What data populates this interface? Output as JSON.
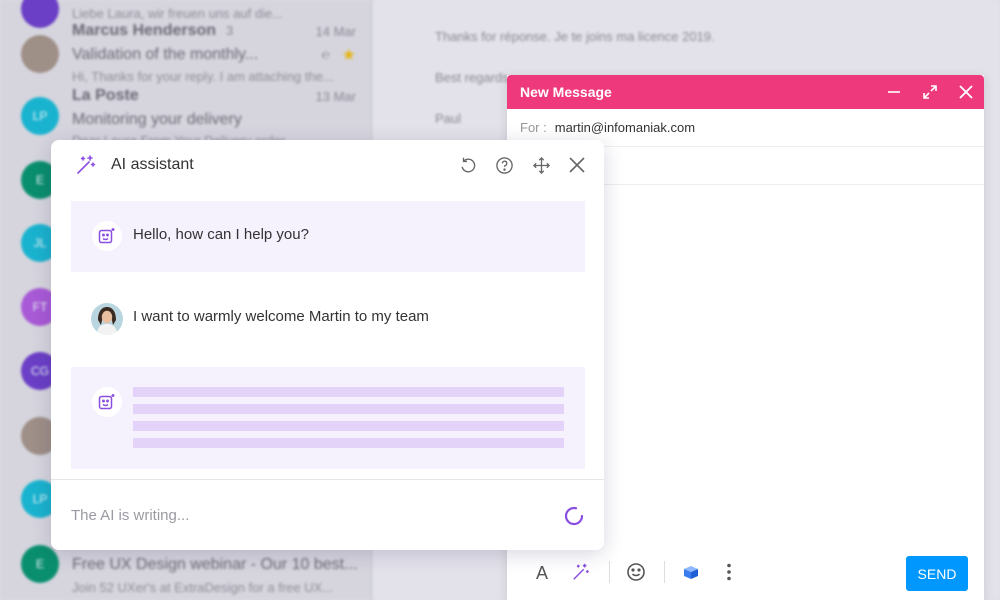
{
  "mail_list": {
    "rows": [
      {
        "preview": "Liebe Laura, wir freuen uns auf die..."
      },
      {
        "sender": "Marcus Henderson",
        "count": "3",
        "date": "14 Mar",
        "subject": "Validation of the monthly...",
        "preview": "Hi, Thanks for your reply. I am attaching the..."
      },
      {
        "sender": "La Poste",
        "date": "13 Mar",
        "subject": "Monitoring your delivery",
        "preview": "Dear Laura From Your Delivery order"
      },
      {
        "avatar": "E"
      },
      {
        "avatar": "JL"
      },
      {
        "avatar": "FT"
      },
      {
        "avatar": "CG"
      },
      {
        "avatar": "LP"
      },
      {
        "avatar": "E",
        "subject": "Free UX Design webinar - Our 10 best...",
        "preview": "Join 52 UXer's at ExtraDesign for a free UX..."
      }
    ],
    "avatar_initials_lp": "LP"
  },
  "reading_pane": {
    "lines": [
      "Thanks for réponse. Je te joins ma licence 2019.",
      "Best regards",
      "Paul"
    ]
  },
  "compose": {
    "title": "New Message",
    "to_label": "For :",
    "to_value": "martin@infomaniak.com",
    "send_label": "SEND",
    "header_color": "#ee3a7c",
    "send_color": "#0098ff"
  },
  "ai_assistant": {
    "title": "AI assistant",
    "greeting": "Hello, how can I help you?",
    "user_message": "I want to warmly welcome Martin to my team",
    "status": "The AI is writing...",
    "accent_color": "#8a4fe0",
    "bubble_color": "#f5f1fd",
    "icons": [
      "magic-wand-icon",
      "undo-icon",
      "help-icon",
      "move-icon",
      "close-icon",
      "bot-icon",
      "spinner-icon"
    ]
  }
}
